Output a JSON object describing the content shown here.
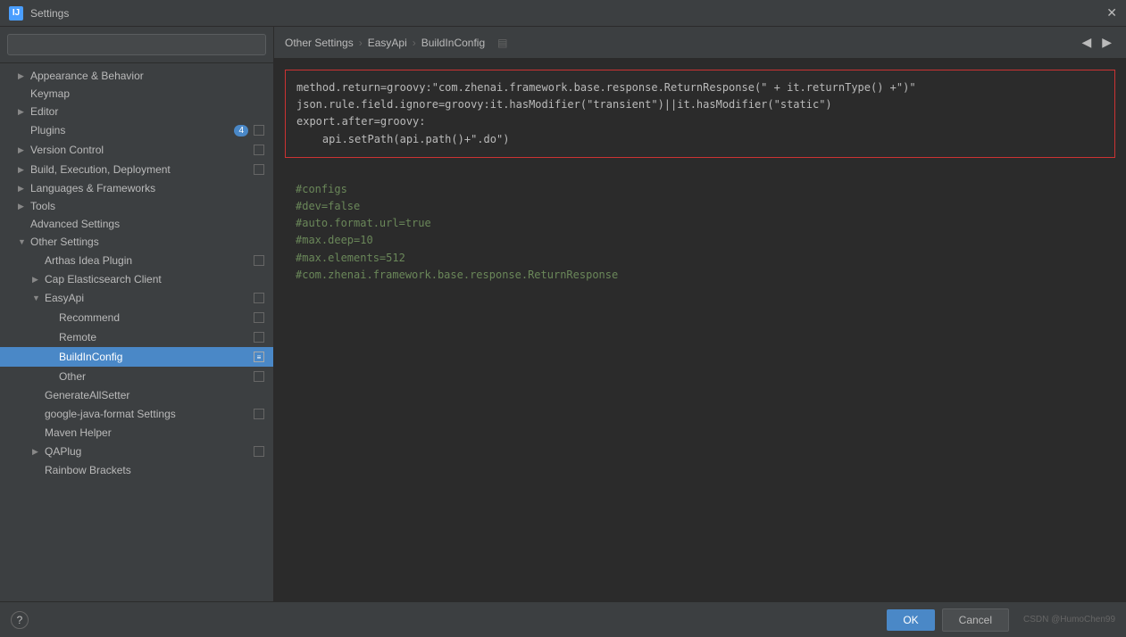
{
  "window": {
    "title": "Settings",
    "logo": "IJ"
  },
  "search": {
    "placeholder": ""
  },
  "breadcrumb": {
    "items": [
      "Other Settings",
      "EasyApi",
      "BuildInConfig"
    ],
    "icon": "file-icon"
  },
  "sidebar": {
    "items": [
      {
        "id": "appearance",
        "label": "Appearance & Behavior",
        "indent": 1,
        "arrow": "▶",
        "has_ext": false
      },
      {
        "id": "keymap",
        "label": "Keymap",
        "indent": 1,
        "arrow": "",
        "has_ext": false
      },
      {
        "id": "editor",
        "label": "Editor",
        "indent": 1,
        "arrow": "▶",
        "has_ext": false
      },
      {
        "id": "plugins",
        "label": "Plugins",
        "indent": 1,
        "arrow": "",
        "has_ext": false,
        "badge": "4"
      },
      {
        "id": "version-control",
        "label": "Version Control",
        "indent": 1,
        "arrow": "▶",
        "has_ext": true
      },
      {
        "id": "build-execution",
        "label": "Build, Execution, Deployment",
        "indent": 1,
        "arrow": "▶",
        "has_ext": true
      },
      {
        "id": "languages",
        "label": "Languages & Frameworks",
        "indent": 1,
        "arrow": "▶",
        "has_ext": false
      },
      {
        "id": "tools",
        "label": "Tools",
        "indent": 1,
        "arrow": "▶",
        "has_ext": false
      },
      {
        "id": "advanced-settings",
        "label": "Advanced Settings",
        "indent": 1,
        "arrow": "",
        "has_ext": false
      },
      {
        "id": "other-settings",
        "label": "Other Settings",
        "indent": 1,
        "arrow": "▼",
        "has_ext": false
      },
      {
        "id": "arthas",
        "label": "Arthas Idea Plugin",
        "indent": 2,
        "arrow": "",
        "has_ext": true
      },
      {
        "id": "cap-elasticsearch",
        "label": "Cap Elasticsearch Client",
        "indent": 2,
        "arrow": "▶",
        "has_ext": false
      },
      {
        "id": "easyapi",
        "label": "EasyApi",
        "indent": 2,
        "arrow": "▼",
        "has_ext": true
      },
      {
        "id": "recommend",
        "label": "Recommend",
        "indent": 3,
        "arrow": "",
        "has_ext": true
      },
      {
        "id": "remote",
        "label": "Remote",
        "indent": 3,
        "arrow": "",
        "has_ext": true
      },
      {
        "id": "buildinconfig",
        "label": "BuildInConfig",
        "indent": 3,
        "arrow": "",
        "has_ext": true,
        "selected": true
      },
      {
        "id": "other",
        "label": "Other",
        "indent": 3,
        "arrow": "",
        "has_ext": true
      },
      {
        "id": "generateallsetter",
        "label": "GenerateAllSetter",
        "indent": 2,
        "arrow": "",
        "has_ext": false
      },
      {
        "id": "google-java-format",
        "label": "google-java-format Settings",
        "indent": 2,
        "arrow": "",
        "has_ext": true
      },
      {
        "id": "maven-helper",
        "label": "Maven Helper",
        "indent": 2,
        "arrow": "",
        "has_ext": false
      },
      {
        "id": "qaplug",
        "label": "QAPlug",
        "indent": 2,
        "arrow": "▶",
        "has_ext": true
      },
      {
        "id": "rainbow-brackets",
        "label": "Rainbow Brackets",
        "indent": 2,
        "arrow": "",
        "has_ext": false
      }
    ]
  },
  "content": {
    "error_code": "method.return=groovy:\"com.zhenai.framework.base.response.ReturnResponse(\" + it.returnType() +\")\"\njson.rule.field.ignore=groovy:it.hasModifier(\"transient\")||it.hasModifier(\"static\")\nexport.after=groovy:\n    api.setPath(api.path()+\".do\")",
    "normal_code": "#configs\n#dev=false\n#auto.format.url=true\n#max.deep=10\n#max.elements=512\n#com.zhenai.framework.base.response.ReturnResponse"
  },
  "buttons": {
    "ok": "OK",
    "cancel": "Cancel",
    "help": "?",
    "back": "◀",
    "forward": "▶"
  },
  "watermark": "CSDN @HumoChen99"
}
